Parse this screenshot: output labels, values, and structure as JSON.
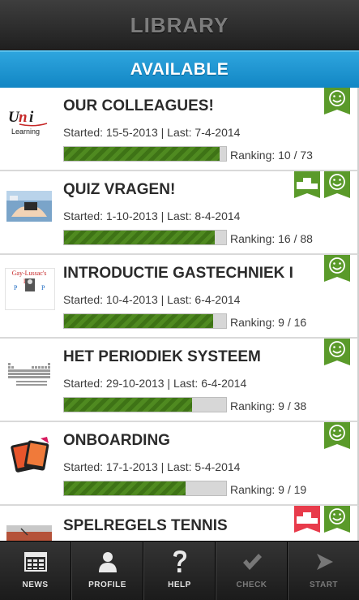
{
  "header": {
    "title": "LIBRARY"
  },
  "tab": {
    "title": "AVAILABLE"
  },
  "courses": [
    {
      "title": "OUR COLLEAGUES!",
      "dates": "Started: 15-5-2013 | Last: 7-4-2014",
      "ranking": "Ranking: 10 / 73",
      "progress": 0.96,
      "thumb_text": "Learning",
      "badges": [
        "smiley"
      ]
    },
    {
      "title": "QUIZ VRAGEN!",
      "dates": "Started: 1-10-2013 | Last: 8-4-2014",
      "ranking": "Ranking: 16 / 88",
      "progress": 0.93,
      "badges": [
        "podium",
        "smiley"
      ]
    },
    {
      "title": "INTRODUCTIE GASTECHNIEK I",
      "dates": "Started: 10-4-2013 | Last: 6-4-2014",
      "ranking": "Ranking: 9 / 16",
      "progress": 0.92,
      "thumb_text": "Gay-Lussac's Law",
      "badges": [
        "smiley"
      ]
    },
    {
      "title": "HET PERIODIEK SYSTEEM",
      "dates": "Started: 29-10-2013 | Last: 6-4-2014",
      "ranking": "Ranking: 9 / 38",
      "progress": 0.79,
      "badges": [
        "smiley"
      ]
    },
    {
      "title": "ONBOARDING",
      "dates": "Started: 17-1-2013 | Last: 5-4-2014",
      "ranking": "Ranking: 9 / 19",
      "progress": 0.75,
      "badges": [
        "smiley"
      ]
    },
    {
      "title": "SPELREGELS TENNIS",
      "dates": "",
      "ranking": "",
      "progress": 0,
      "badges": [
        "podium-red",
        "smiley"
      ]
    }
  ],
  "nav": [
    {
      "label": "NEWS",
      "icon": "news-icon",
      "enabled": true
    },
    {
      "label": "PROFILE",
      "icon": "profile-icon",
      "enabled": true
    },
    {
      "label": "HELP",
      "icon": "help-icon",
      "enabled": true
    },
    {
      "label": "CHECK",
      "icon": "check-icon",
      "enabled": false
    },
    {
      "label": "START",
      "icon": "start-icon",
      "enabled": false
    }
  ],
  "colors": {
    "accent_blue": "#1a95d3",
    "badge_green": "#5a9a2a",
    "badge_red": "#e83b4b",
    "progress_green": "#4f8a20"
  }
}
